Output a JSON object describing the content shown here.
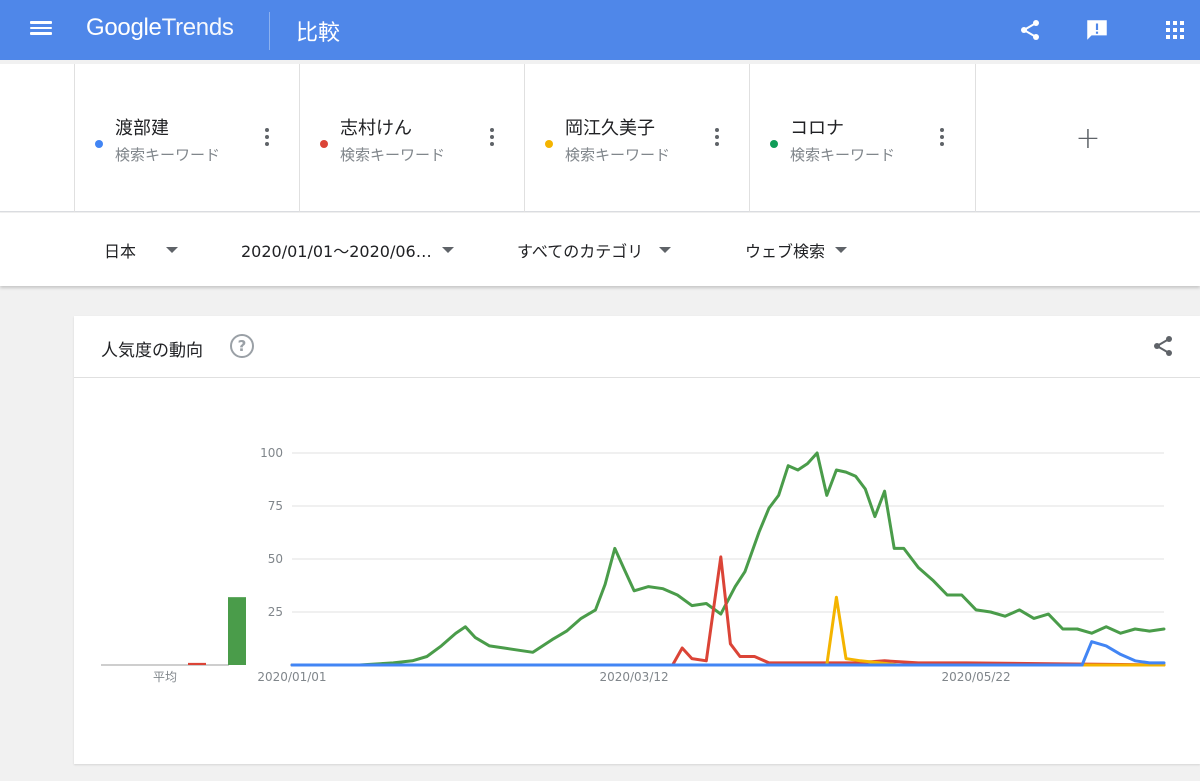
{
  "header": {
    "logo_google": "Google",
    "logo_trends": "Trends",
    "page_title": "比較",
    "icons": [
      "menu-icon",
      "share-icon",
      "feedback-icon",
      "apps-grid-icon"
    ]
  },
  "terms": [
    {
      "name": "渡部建",
      "type": "検索キーワード",
      "color": "#4285f4"
    },
    {
      "name": "志村けん",
      "type": "検索キーワード",
      "color": "#db4437"
    },
    {
      "name": "岡江久美子",
      "type": "検索キーワード",
      "color": "#f4b400"
    },
    {
      "name": "コロナ",
      "type": "検索キーワード",
      "color": "#0f9d58"
    }
  ],
  "add_term_label": "+",
  "filters": {
    "region": "日本",
    "date_range": "2020/01/01〜2020/06…",
    "category": "すべてのカテゴリ",
    "search_type": "ウェブ検索"
  },
  "card": {
    "title": "人気度の動向",
    "help_label": "?",
    "average_label": "平均"
  },
  "chart_data": {
    "type": "line",
    "y_ticks": [
      "100",
      "75",
      "50",
      "25"
    ],
    "ylim": [
      0,
      100
    ],
    "x_tick_labels": [
      "2020/01/01",
      "2020/03/12",
      "2020/05/22"
    ],
    "x_range": [
      "2020/01/01",
      "2020/06/30"
    ],
    "grid": true,
    "averages": [
      {
        "name": "渡部建",
        "value": 0,
        "color": "#4285f4"
      },
      {
        "name": "志村けん",
        "value": 1,
        "color": "#db4437"
      },
      {
        "name": "岡江久美子",
        "value": 0,
        "color": "#f4b400"
      },
      {
        "name": "コロナ",
        "value": 32,
        "color": "#4a9c4a"
      }
    ],
    "series": [
      {
        "name": "コロナ",
        "color": "#4a9c4a",
        "points": [
          [
            "2020/01/01",
            0
          ],
          [
            "2020/01/08",
            0
          ],
          [
            "2020/01/15",
            0
          ],
          [
            "2020/01/22",
            1
          ],
          [
            "2020/01/26",
            2
          ],
          [
            "2020/01/29",
            4
          ],
          [
            "2020/02/01",
            9
          ],
          [
            "2020/02/04",
            15
          ],
          [
            "2020/02/06",
            18
          ],
          [
            "2020/02/08",
            13
          ],
          [
            "2020/02/11",
            9
          ],
          [
            "2020/02/14",
            8
          ],
          [
            "2020/02/17",
            7
          ],
          [
            "2020/02/20",
            6
          ],
          [
            "2020/02/24",
            12
          ],
          [
            "2020/02/27",
            16
          ],
          [
            "2020/03/01",
            22
          ],
          [
            "2020/03/04",
            26
          ],
          [
            "2020/03/06",
            38
          ],
          [
            "2020/03/08",
            55
          ],
          [
            "2020/03/10",
            45
          ],
          [
            "2020/03/12",
            35
          ],
          [
            "2020/03/15",
            37
          ],
          [
            "2020/03/18",
            36
          ],
          [
            "2020/03/21",
            33
          ],
          [
            "2020/03/24",
            28
          ],
          [
            "2020/03/27",
            29
          ],
          [
            "2020/03/30",
            24
          ],
          [
            "2020/04/02",
            37
          ],
          [
            "2020/04/04",
            44
          ],
          [
            "2020/04/07",
            63
          ],
          [
            "2020/04/09",
            74
          ],
          [
            "2020/04/11",
            80
          ],
          [
            "2020/04/13",
            94
          ],
          [
            "2020/04/15",
            92
          ],
          [
            "2020/04/17",
            95
          ],
          [
            "2020/04/19",
            100
          ],
          [
            "2020/04/21",
            80
          ],
          [
            "2020/04/23",
            92
          ],
          [
            "2020/04/25",
            91
          ],
          [
            "2020/04/27",
            89
          ],
          [
            "2020/04/29",
            83
          ],
          [
            "2020/05/01",
            70
          ],
          [
            "2020/05/03",
            82
          ],
          [
            "2020/05/05",
            55
          ],
          [
            "2020/05/07",
            55
          ],
          [
            "2020/05/10",
            46
          ],
          [
            "2020/05/13",
            40
          ],
          [
            "2020/05/16",
            33
          ],
          [
            "2020/05/19",
            33
          ],
          [
            "2020/05/22",
            26
          ],
          [
            "2020/05/25",
            25
          ],
          [
            "2020/05/28",
            23
          ],
          [
            "2020/05/31",
            26
          ],
          [
            "2020/06/03",
            22
          ],
          [
            "2020/06/06",
            24
          ],
          [
            "2020/06/09",
            17
          ],
          [
            "2020/06/12",
            17
          ],
          [
            "2020/06/15",
            15
          ],
          [
            "2020/06/18",
            18
          ],
          [
            "2020/06/21",
            15
          ],
          [
            "2020/06/24",
            17
          ],
          [
            "2020/06/27",
            16
          ],
          [
            "2020/06/30",
            17
          ]
        ]
      },
      {
        "name": "志村けん",
        "color": "#db4437",
        "points": [
          [
            "2020/01/01",
            0
          ],
          [
            "2020/03/20",
            0
          ],
          [
            "2020/03/22",
            8
          ],
          [
            "2020/03/24",
            3
          ],
          [
            "2020/03/27",
            2
          ],
          [
            "2020/03/30",
            51
          ],
          [
            "2020/04/01",
            10
          ],
          [
            "2020/04/03",
            4
          ],
          [
            "2020/04/06",
            4
          ],
          [
            "2020/04/09",
            1
          ],
          [
            "2020/04/13",
            1
          ],
          [
            "2020/04/20",
            1
          ],
          [
            "2020/04/27",
            1
          ],
          [
            "2020/05/03",
            2
          ],
          [
            "2020/05/10",
            1
          ],
          [
            "2020/05/20",
            1
          ],
          [
            "2020/06/30",
            0
          ]
        ]
      },
      {
        "name": "岡江久美子",
        "color": "#f4b400",
        "points": [
          [
            "2020/01/01",
            0
          ],
          [
            "2020/04/21",
            0
          ],
          [
            "2020/04/23",
            32
          ],
          [
            "2020/04/25",
            3
          ],
          [
            "2020/04/28",
            2
          ],
          [
            "2020/05/02",
            1
          ],
          [
            "2020/05/06",
            0
          ],
          [
            "2020/06/30",
            0
          ]
        ]
      },
      {
        "name": "渡部建",
        "color": "#4285f4",
        "points": [
          [
            "2020/01/01",
            0
          ],
          [
            "2020/06/13",
            0
          ],
          [
            "2020/06/15",
            11
          ],
          [
            "2020/06/18",
            9
          ],
          [
            "2020/06/21",
            5
          ],
          [
            "2020/06/24",
            2
          ],
          [
            "2020/06/27",
            1
          ],
          [
            "2020/06/30",
            1
          ]
        ]
      }
    ]
  }
}
